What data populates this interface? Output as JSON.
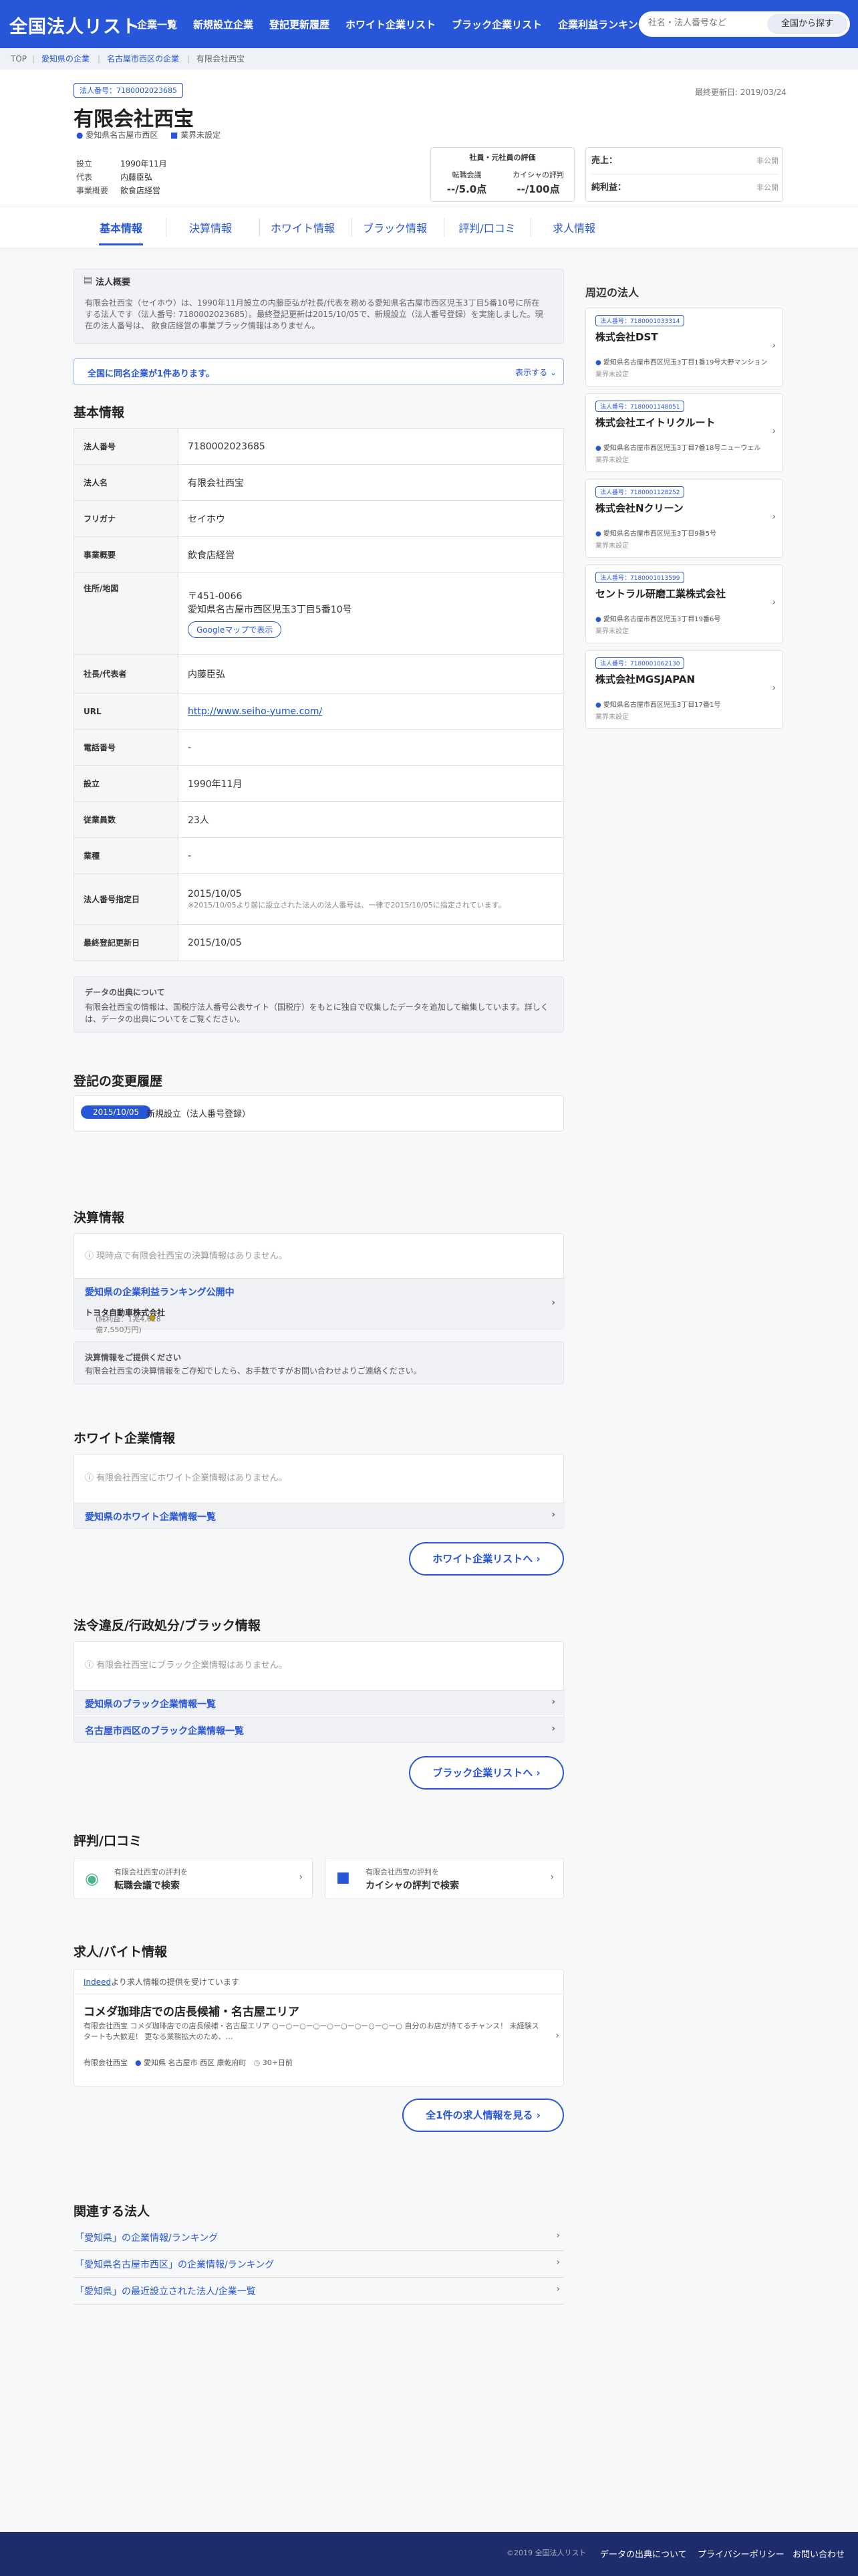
{
  "header": {
    "logo": "全国法人リスト",
    "nav": [
      "企業一覧",
      "新規設立企業",
      "登記更新履歴",
      "ホワイト企業リスト",
      "ブラック企業リスト",
      "企業利益ランキング"
    ],
    "search_placeholder": "社名・法人番号など",
    "search_button": "全国から探す"
  },
  "breadcrumb": [
    "TOP",
    "愛知県の企業",
    "名古屋市西区の企業",
    "有限会社西宝"
  ],
  "company": {
    "corp_no_label": "法人番号：7180002023685",
    "updated": "最終更新日: 2019/03/24",
    "name": "有限会社西宝",
    "location": "愛知県名古屋市西区",
    "industry": "業界未設定",
    "founded_label": "設立",
    "founded": "1990年11月",
    "rep_label": "代表",
    "rep": "内藤臣弘",
    "business_label": "事業概要",
    "business": "飲食店経営"
  },
  "evaluation": {
    "title": "社員・元社員の評価",
    "tenshoku_label": "転職会議",
    "tenshoku_value": "--/5.0点",
    "kaisha_label": "カイシャの評判",
    "kaisha_value": "--/100点"
  },
  "sales": {
    "sales_label": "売上：",
    "sales_value": "非公開",
    "profit_label": "純利益：",
    "profit_value": "非公開"
  },
  "tabs": [
    "基本情報",
    "決算情報",
    "ホワイト情報",
    "ブラック情報",
    "評判/口コミ",
    "求人情報"
  ],
  "summary": {
    "title": "法人概要",
    "text": "有限会社西宝（セイホウ）は、1990年11月設立の内藤臣弘が社長/代表を務める愛知県名古屋市西区児玉3丁目5番10号に所在する法人です（法人番号: 7180002023685）。最終登記更新は2015/10/05で、新規設立（法人番号登録）を実施しました。現在の法人番号は、 飲食店経営の事業ブラック情報はありません。",
    "same_name": "全国に同名企業が1件あります。",
    "same_more": "表示する ⌄"
  },
  "basic": {
    "title": "基本情報",
    "rows": [
      {
        "k": "法人番号",
        "v": "7180002023685"
      },
      {
        "k": "法人名",
        "v": "有限会社西宝"
      },
      {
        "k": "フリガナ",
        "v": "セイホウ"
      },
      {
        "k": "事業概要",
        "v": "飲食店経営"
      },
      {
        "k": "住所/地図",
        "v": "〒451-0066",
        "v2": "愛知県名古屋市西区児玉3丁目5番10号",
        "btn": "Googleマップで表示"
      },
      {
        "k": "社長/代表者",
        "v": "内藤臣弘"
      },
      {
        "k": "URL",
        "v": "http://www.seiho-yume.com/"
      },
      {
        "k": "電話番号",
        "v": "-"
      },
      {
        "k": "設立",
        "v": "1990年11月"
      },
      {
        "k": "従業員数",
        "v": "23人"
      },
      {
        "k": "業種",
        "v": "-"
      },
      {
        "k": "法人番号指定日",
        "v": "2015/10/05",
        "v2": "※2015/10/05より前に設立された法人の法人番号は、一律で2015/10/05に指定されています。"
      },
      {
        "k": "最終登記更新日",
        "v": "2015/10/05"
      }
    ]
  },
  "datasource": {
    "title": "データの出典について",
    "text": "有限会社西宝の情報は、国税庁法人番号公表サイト（国税庁）をもとに独自で収集したデータを追加して編集しています。詳しくは、データの出典についてをご覧ください。"
  },
  "history": {
    "title": "登記の変更履歴",
    "date": "2015/10/05",
    "text": "新規設立（法人番号登録）"
  },
  "finance": {
    "title": "決算情報",
    "empty": "現時点で有限会社西宝の決算情報はありません。",
    "rank_title": "愛知県の企業利益ランキング公開中",
    "rank_top": "トヨタ自動車株式会社",
    "rank_detail": "(純利益：1兆4,628億7,550万円)",
    "note_title": "決算情報をご提供ください",
    "note_text": "有限会社西宝の決算情報をご存知でしたら、お手数ですがお問い合わせよりご連絡ください。"
  },
  "white": {
    "title": "ホワイト企業情報",
    "empty": "有限会社西宝にホワイト企業情報はありません。",
    "link": "愛知県のホワイト企業情報一覧",
    "btn": "ホワイト企業リストへ ›"
  },
  "black": {
    "title": "法令違反/行政処分/ブラック情報",
    "empty": "有限会社西宝にブラック企業情報はありません。",
    "link1": "愛知県のブラック企業情報一覧",
    "link2": "名古屋市西区のブラック企業情報一覧",
    "btn": "ブラック企業リストへ ›"
  },
  "reputation": {
    "title": "評判/口コミ",
    "card1_sub": "有限会社西宝の評判を",
    "card1_main": "転職会議で検索",
    "card2_sub": "有限会社西宝の評判を",
    "card2_main": "カイシャの評判で検索"
  },
  "jobs": {
    "title": "求人/バイト情報",
    "indeed": "Indeed",
    "indeed_text": "より求人情報の提供を受けています",
    "job_title": "コメダ珈琲店での店長候補・名古屋エリア",
    "job_desc": "有限会社西宝 コメダ珈琲店での店長候補・名古屋エリア ○ー○ー○ー○ー○ー○ー○ー○ー○ー○ 自分のお店が持てるチャンス！ 未経験スタートも大歓迎！ 更なる業務拡大のため、…",
    "job_company": "有限会社西宝",
    "job_loc": "愛知県 名古屋市 西区 康乾府町",
    "job_age": "30+日前",
    "btn": "全1件の求人情報を見る ›"
  },
  "related": {
    "title": "関連する法人",
    "links": [
      "「愛知県」の企業情報/ランキング",
      "「愛知県名古屋市西区」の企業情報/ランキング",
      "「愛知県」の最近設立された法人/企業一覧"
    ]
  },
  "sidebar": {
    "title": "周辺の法人",
    "industry": "業界未設定",
    "items": [
      {
        "no": "法人番号：7180001033314",
        "name": "株式会社DST",
        "addr": "愛知県名古屋市西区児玉3丁目1番19号大野マンション"
      },
      {
        "no": "法人番号：7180001148051",
        "name": "株式会社エイトリクルート",
        "addr": "愛知県名古屋市西区児玉3丁目7番18号ニューウェル"
      },
      {
        "no": "法人番号：7180001128252",
        "name": "株式会社Nクリーン",
        "addr": "愛知県名古屋市西区児玉3丁目9番5号"
      },
      {
        "no": "法人番号：7180001013599",
        "name": "セントラル研磨工業株式会社",
        "addr": "愛知県名古屋市西区児玉3丁目19番6号"
      },
      {
        "no": "法人番号：7180001062130",
        "name": "株式会社MGSJAPAN",
        "addr": "愛知県名古屋市西区児玉3丁目17番1号"
      }
    ]
  },
  "footer": {
    "copyright": "©2019 全国法人リスト",
    "links": [
      "データの出典について",
      "プライバシーポリシー",
      "お問い合わせ"
    ]
  }
}
